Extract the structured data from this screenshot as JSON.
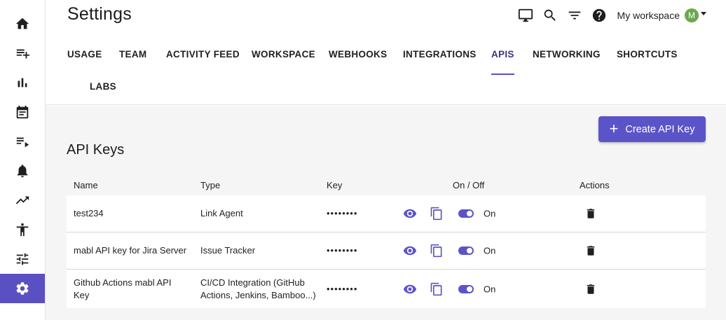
{
  "header": {
    "title": "Settings",
    "workspace_label": "My workspace",
    "avatar_initial": "M"
  },
  "tabs": [
    {
      "label": "USAGE"
    },
    {
      "label": "TEAM"
    },
    {
      "label": "ACTIVITY FEED"
    },
    {
      "label": "WORKSPACE"
    },
    {
      "label": "WEBHOOKS"
    },
    {
      "label": "INTEGRATIONS"
    },
    {
      "label": "APIS",
      "active": true
    },
    {
      "label": "NETWORKING"
    },
    {
      "label": "SHORTCUTS"
    },
    {
      "label": "LABS"
    }
  ],
  "main": {
    "create_button_label": "Create API Key",
    "section_title": "API Keys"
  },
  "table": {
    "headers": {
      "name": "Name",
      "type": "Type",
      "key": "Key",
      "onoff": "On / Off",
      "actions": "Actions"
    },
    "rows": [
      {
        "name": "test234",
        "type": "Link Agent",
        "key": "••••••••",
        "status": "On"
      },
      {
        "name": "mabl API key for Jira Server",
        "type": "Issue Tracker",
        "key": "••••••••",
        "status": "On"
      },
      {
        "name": "Github Actions mabl API Key",
        "type": "CI/CD Integration (GitHub Actions, Jenkins, Bamboo...)",
        "key": "••••••••",
        "status": "On"
      }
    ]
  },
  "colors": {
    "accent": "#5b54c8",
    "active_sidebar": "#5b4fc4",
    "avatar": "#6aa84f"
  },
  "icons": {
    "sidebar": [
      "home-icon",
      "playlist-add-icon",
      "bar-chart-icon",
      "calendar-icon",
      "playlist-play-icon",
      "bell-icon",
      "trending-up-icon",
      "accessibility-icon",
      "tune-icon",
      "gear-icon"
    ],
    "top": [
      "desktop-icon",
      "search-icon",
      "filter-icon",
      "help-icon"
    ]
  }
}
